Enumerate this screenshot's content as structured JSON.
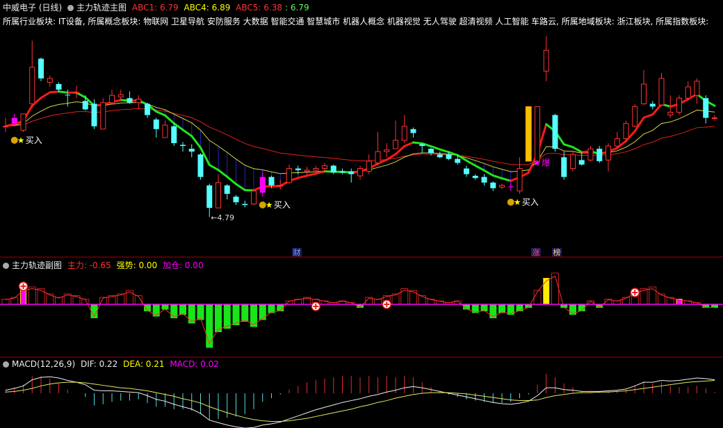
{
  "main_header": {
    "stock": "中威电子 (日线)",
    "indicator": "主力轨迹主图",
    "abc1": "ABC1: 6.79",
    "abc4": "ABC4: 6.89",
    "abc5": "ABC5: 6.38",
    "abc5b": ": 6.79"
  },
  "sector_line": "所属行业板块: IT设备, 所属概念板块: 物联网 卫星导航 安防服务 大数据 智能交通 智慧城市 机器人概念 机器视觉 无人驾驶 超清视频 人工智能 车路云, 所属地域板块: 浙江板块, 所属指数板块:",
  "sub_header": {
    "indicator": "主力轨迹副图",
    "zhuli": "主力: -0.65",
    "qiangshi": "强势: 0.00",
    "jiacang": "加仓: 0.00"
  },
  "macd_header": {
    "name": "MACD(12,26,9)",
    "dif": "DIF: 0.22",
    "dea": "DEA: 0.21",
    "macd": "MACD: 0.02"
  },
  "colors": {
    "up": "#ff3232",
    "down": "#54ffff",
    "signal_magenta": "#ff00ff",
    "label_red": "#ff3232",
    "label_yellow": "#ffff00",
    "label_magenta": "#ff00ff",
    "grid_red": "#aa0000"
  },
  "chart_data": [
    {
      "type": "candlestick",
      "name": "中威电子 (日线)",
      "price_axis_range": [
        4.2,
        8.1
      ],
      "low_label": "4.79",
      "candles": [
        {
          "o": 6.4,
          "h": 6.55,
          "l": 6.3,
          "c": 6.4
        },
        {
          "o": 6.45,
          "h": 6.62,
          "l": 6.4,
          "c": 6.55
        },
        {
          "o": 6.33,
          "h": 6.62,
          "l": 6.3,
          "c": 6.62
        },
        {
          "o": 6.8,
          "h": 7.92,
          "l": 6.72,
          "c": 7.45
        },
        {
          "o": 7.6,
          "h": 7.62,
          "l": 7.2,
          "c": 7.25
        },
        {
          "o": 7.18,
          "h": 7.3,
          "l": 7.1,
          "c": 7.25
        },
        {
          "o": 7.15,
          "h": 7.18,
          "l": 7.02,
          "c": 7.05
        },
        {
          "o": 6.96,
          "h": 7.05,
          "l": 6.75,
          "c": 6.95
        },
        {
          "o": 7.0,
          "h": 7.12,
          "l": 6.9,
          "c": 7.0
        },
        {
          "o": 6.85,
          "h": 6.95,
          "l": 6.68,
          "c": 6.7
        },
        {
          "o": 6.8,
          "h": 6.88,
          "l": 6.35,
          "c": 6.4
        },
        {
          "o": 6.35,
          "h": 6.9,
          "l": 6.35,
          "c": 6.82
        },
        {
          "o": 6.82,
          "h": 7.05,
          "l": 6.8,
          "c": 6.95
        },
        {
          "o": 6.92,
          "h": 7.05,
          "l": 6.85,
          "c": 6.96
        },
        {
          "o": 6.9,
          "h": 7.02,
          "l": 6.8,
          "c": 6.82
        },
        {
          "o": 6.82,
          "h": 6.95,
          "l": 6.7,
          "c": 6.88
        },
        {
          "o": 6.8,
          "h": 6.82,
          "l": 6.55,
          "c": 6.6
        },
        {
          "o": 6.52,
          "h": 6.55,
          "l": 6.2,
          "c": 6.35
        },
        {
          "o": 6.2,
          "h": 6.5,
          "l": 6.2,
          "c": 6.42
        },
        {
          "o": 6.4,
          "h": 6.45,
          "l": 6.05,
          "c": 6.1
        },
        {
          "o": 6.07,
          "h": 6.12,
          "l": 5.95,
          "c": 6.05
        },
        {
          "o": 6.0,
          "h": 6.08,
          "l": 5.85,
          "c": 5.95
        },
        {
          "o": 5.9,
          "h": 5.92,
          "l": 5.45,
          "c": 5.5
        },
        {
          "o": 5.35,
          "h": 5.38,
          "l": 4.79,
          "c": 4.95
        },
        {
          "o": 4.95,
          "h": 5.55,
          "l": 4.95,
          "c": 5.4
        },
        {
          "o": 5.35,
          "h": 5.37,
          "l": 5.1,
          "c": 5.2
        },
        {
          "o": 5.15,
          "h": 5.18,
          "l": 5.0,
          "c": 5.05
        },
        {
          "o": 5.02,
          "h": 5.08,
          "l": 4.96,
          "c": 5.0
        },
        {
          "o": 5.02,
          "h": 5.28,
          "l": 5.0,
          "c": 5.25
        },
        {
          "o": 5.22,
          "h": 5.6,
          "l": 5.15,
          "c": 5.5
        },
        {
          "o": 5.5,
          "h": 5.52,
          "l": 5.3,
          "c": 5.35
        },
        {
          "o": 5.35,
          "h": 5.45,
          "l": 5.28,
          "c": 5.35
        },
        {
          "o": 5.4,
          "h": 5.72,
          "l": 5.38,
          "c": 5.65
        },
        {
          "o": 5.65,
          "h": 5.7,
          "l": 5.55,
          "c": 5.62
        },
        {
          "o": 5.6,
          "h": 5.68,
          "l": 5.55,
          "c": 5.62
        },
        {
          "o": 5.62,
          "h": 5.7,
          "l": 5.58,
          "c": 5.65
        },
        {
          "o": 5.65,
          "h": 5.75,
          "l": 5.6,
          "c": 5.7
        },
        {
          "o": 5.7,
          "h": 5.72,
          "l": 5.55,
          "c": 5.58
        },
        {
          "o": 5.6,
          "h": 5.65,
          "l": 5.55,
          "c": 5.58
        },
        {
          "o": 5.6,
          "h": 5.65,
          "l": 5.4,
          "c": 5.55
        },
        {
          "o": 5.52,
          "h": 5.7,
          "l": 5.45,
          "c": 5.65
        },
        {
          "o": 5.6,
          "h": 5.9,
          "l": 5.55,
          "c": 5.78
        },
        {
          "o": 5.75,
          "h": 6.3,
          "l": 5.7,
          "c": 5.95
        },
        {
          "o": 5.95,
          "h": 6.1,
          "l": 5.85,
          "c": 5.98
        },
        {
          "o": 6.0,
          "h": 6.5,
          "l": 6.0,
          "c": 6.15
        },
        {
          "o": 6.15,
          "h": 6.6,
          "l": 6.1,
          "c": 6.4
        },
        {
          "o": 6.35,
          "h": 6.38,
          "l": 6.2,
          "c": 6.28
        },
        {
          "o": 6.08,
          "h": 6.1,
          "l": 5.92,
          "c": 6.05
        },
        {
          "o": 6.0,
          "h": 6.02,
          "l": 5.88,
          "c": 5.92
        },
        {
          "o": 5.9,
          "h": 5.95,
          "l": 5.83,
          "c": 5.85
        },
        {
          "o": 5.9,
          "h": 5.95,
          "l": 5.8,
          "c": 5.82
        },
        {
          "o": 5.82,
          "h": 5.9,
          "l": 5.72,
          "c": 5.75
        },
        {
          "o": 5.65,
          "h": 5.7,
          "l": 5.5,
          "c": 5.55
        },
        {
          "o": 5.52,
          "h": 5.55,
          "l": 5.45,
          "c": 5.48
        },
        {
          "o": 5.5,
          "h": 5.55,
          "l": 5.35,
          "c": 5.4
        },
        {
          "o": 5.4,
          "h": 5.42,
          "l": 5.25,
          "c": 5.3
        },
        {
          "o": 5.32,
          "h": 5.38,
          "l": 5.28,
          "c": 5.35
        },
        {
          "o": 5.33,
          "h": 5.45,
          "l": 5.25,
          "c": 5.32
        },
        {
          "o": 5.25,
          "h": 5.85,
          "l": 5.2,
          "c": 5.65
        },
        {
          "o": 5.62,
          "h": 5.8,
          "l": 5.6,
          "c": 5.78
        },
        {
          "o": 5.78,
          "h": 6.75,
          "l": 5.75,
          "c": 6.75
        },
        {
          "o": 7.38,
          "h": 8.0,
          "l": 7.2,
          "c": 7.75
        },
        {
          "o": 6.6,
          "h": 6.62,
          "l": 5.95,
          "c": 6.0
        },
        {
          "o": 5.85,
          "h": 5.95,
          "l": 5.45,
          "c": 5.5
        },
        {
          "o": 5.65,
          "h": 5.95,
          "l": 5.6,
          "c": 5.9
        },
        {
          "o": 5.8,
          "h": 5.95,
          "l": 5.7,
          "c": 5.72
        },
        {
          "o": 5.8,
          "h": 6.05,
          "l": 5.78,
          "c": 6.0
        },
        {
          "o": 6.0,
          "h": 6.05,
          "l": 5.75,
          "c": 5.78
        },
        {
          "o": 5.8,
          "h": 6.1,
          "l": 5.6,
          "c": 6.05
        },
        {
          "o": 6.05,
          "h": 6.3,
          "l": 6.0,
          "c": 6.18
        },
        {
          "o": 6.18,
          "h": 6.5,
          "l": 6.12,
          "c": 6.45
        },
        {
          "o": 6.4,
          "h": 6.8,
          "l": 6.38,
          "c": 6.75
        },
        {
          "o": 6.8,
          "h": 7.4,
          "l": 6.78,
          "c": 7.15
        },
        {
          "o": 6.8,
          "h": 6.85,
          "l": 6.7,
          "c": 6.75
        },
        {
          "o": 6.78,
          "h": 7.35,
          "l": 6.75,
          "c": 7.25
        },
        {
          "o": 6.6,
          "h": 6.95,
          "l": 6.55,
          "c": 6.65
        },
        {
          "o": 6.65,
          "h": 6.95,
          "l": 6.6,
          "c": 6.9
        },
        {
          "o": 6.9,
          "h": 7.2,
          "l": 6.85,
          "c": 7.1
        },
        {
          "o": 6.95,
          "h": 7.25,
          "l": 6.8,
          "c": 7.2
        },
        {
          "o": 6.9,
          "h": 6.95,
          "l": 6.45,
          "c": 6.55
        },
        {
          "o": 6.55,
          "h": 6.6,
          "l": 6.5,
          "c": 6.55
        }
      ],
      "labels": {
        "buy": "买入",
        "burst": "爆",
        "cai": "财",
        "zhang": "涨",
        "bang": "榜"
      }
    },
    {
      "type": "bar",
      "name": "主力轨迹副图",
      "values": [
        0.3,
        0.4,
        0.9,
        1.0,
        0.9,
        0.6,
        0.4,
        0.6,
        0.5,
        0.3,
        -0.8,
        0.4,
        0.5,
        0.6,
        0.8,
        0.5,
        -0.4,
        -0.7,
        -0.3,
        -0.8,
        -0.6,
        -1.1,
        -0.9,
        -2.5,
        -1.6,
        -1.4,
        -1.2,
        -1.0,
        -1.3,
        -0.9,
        -0.5,
        -0.4,
        0.2,
        0.3,
        0.4,
        0.3,
        0.2,
        0.1,
        0.2,
        0.1,
        -0.2,
        0.4,
        0.3,
        0.5,
        0.6,
        0.9,
        0.8,
        0.5,
        0.3,
        0.2,
        0.1,
        0.2,
        -0.3,
        -0.5,
        -0.4,
        -0.8,
        -0.5,
        -0.6,
        -0.4,
        -0.2,
        0.8,
        1.5,
        1.8,
        -0.2,
        -0.6,
        -0.4,
        0.2,
        -0.2,
        0.3,
        0.2,
        0.4,
        0.7,
        0.9,
        1.0,
        0.6,
        0.4,
        0.3,
        0.2,
        0.1,
        -0.2,
        -0.2
      ],
      "signal_bars": [
        2,
        61,
        76
      ]
    },
    {
      "type": "line",
      "name": "MACD(12,26,9)",
      "dif": [
        0.05,
        0.08,
        0.12,
        0.22,
        0.26,
        0.27,
        0.25,
        0.21,
        0.18,
        0.14,
        0.05,
        0.04,
        0.04,
        0.03,
        0.02,
        0.01,
        -0.04,
        -0.1,
        -0.13,
        -0.18,
        -0.22,
        -0.26,
        -0.33,
        -0.44,
        -0.48,
        -0.52,
        -0.55,
        -0.57,
        -0.56,
        -0.52,
        -0.5,
        -0.47,
        -0.42,
        -0.37,
        -0.32,
        -0.27,
        -0.23,
        -0.19,
        -0.15,
        -0.12,
        -0.09,
        -0.05,
        -0.02,
        0.02,
        0.05,
        0.09,
        0.11,
        0.09,
        0.06,
        0.03,
        0.0,
        -0.03,
        -0.06,
        -0.09,
        -0.12,
        -0.15,
        -0.17,
        -0.18,
        -0.16,
        -0.13,
        -0.04,
        0.09,
        0.09,
        0.06,
        0.05,
        0.03,
        0.03,
        0.03,
        0.04,
        0.05,
        0.07,
        0.12,
        0.18,
        0.18,
        0.21,
        0.2,
        0.21,
        0.23,
        0.25,
        0.24,
        0.22
      ],
      "dea": [
        0.02,
        0.03,
        0.05,
        0.08,
        0.12,
        0.15,
        0.17,
        0.18,
        0.18,
        0.17,
        0.15,
        0.13,
        0.11,
        0.09,
        0.08,
        0.06,
        0.04,
        0.01,
        -0.02,
        -0.05,
        -0.09,
        -0.12,
        -0.16,
        -0.22,
        -0.27,
        -0.32,
        -0.36,
        -0.4,
        -0.43,
        -0.45,
        -0.46,
        -0.46,
        -0.45,
        -0.43,
        -0.41,
        -0.38,
        -0.35,
        -0.32,
        -0.29,
        -0.26,
        -0.22,
        -0.19,
        -0.15,
        -0.12,
        -0.08,
        -0.05,
        -0.02,
        0.0,
        0.01,
        0.01,
        0.01,
        0.0,
        -0.01,
        -0.03,
        -0.05,
        -0.07,
        -0.09,
        -0.11,
        -0.12,
        -0.12,
        -0.11,
        -0.07,
        -0.04,
        -0.02,
        0.0,
        0.01,
        0.01,
        0.02,
        0.02,
        0.03,
        0.04,
        0.06,
        0.08,
        0.1,
        0.12,
        0.14,
        0.16,
        0.18,
        0.19,
        0.2,
        0.21
      ],
      "macd_hist": [
        0.06,
        0.1,
        0.14,
        0.28,
        0.28,
        0.24,
        0.16,
        0.06,
        0.0,
        -0.06,
        -0.2,
        -0.18,
        -0.14,
        -0.12,
        -0.12,
        -0.1,
        -0.16,
        -0.22,
        -0.22,
        -0.26,
        -0.26,
        -0.28,
        -0.34,
        -0.44,
        -0.42,
        -0.4,
        -0.38,
        -0.34,
        -0.26,
        -0.14,
        -0.08,
        -0.02,
        0.06,
        0.12,
        0.18,
        0.22,
        0.24,
        0.26,
        0.28,
        0.28,
        0.26,
        0.28,
        0.26,
        0.28,
        0.26,
        0.28,
        0.26,
        0.18,
        0.1,
        0.04,
        -0.02,
        -0.06,
        -0.1,
        -0.12,
        -0.14,
        -0.16,
        -0.16,
        -0.14,
        -0.08,
        -0.02,
        0.14,
        0.32,
        0.26,
        0.16,
        0.1,
        0.04,
        0.04,
        0.02,
        0.04,
        0.04,
        0.06,
        0.12,
        0.2,
        0.16,
        0.18,
        0.12,
        0.1,
        0.1,
        0.12,
        0.08,
        0.02
      ]
    }
  ]
}
